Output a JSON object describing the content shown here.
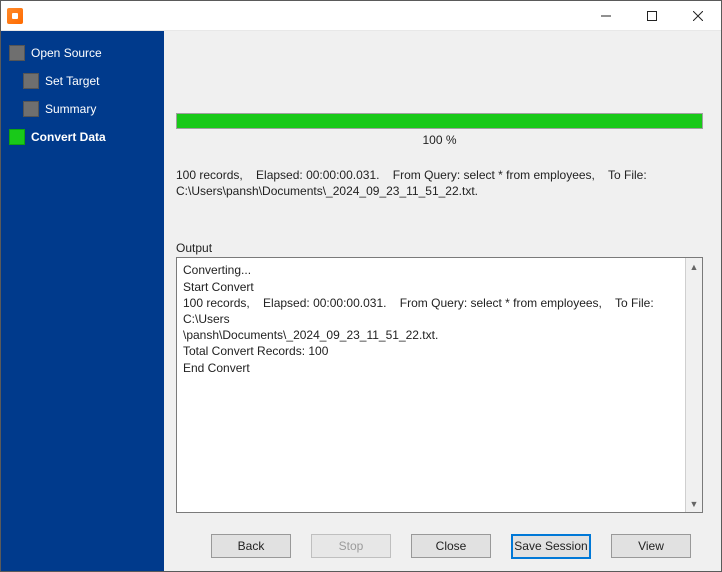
{
  "window": {
    "title": ""
  },
  "sidebar": {
    "items": [
      {
        "label": "Open Source",
        "active": false,
        "child": false
      },
      {
        "label": "Set Target",
        "active": false,
        "child": true
      },
      {
        "label": "Summary",
        "active": false,
        "child": true
      },
      {
        "label": "Convert Data",
        "active": true,
        "child": false
      }
    ]
  },
  "progress": {
    "percent_label": "100 %"
  },
  "summary_line": "100 records,    Elapsed: 00:00:00.031.    From Query: select * from employees,    To File:\nC:\\Users\\pansh\\Documents\\_2024_09_23_11_51_22.txt.",
  "output": {
    "label": "Output",
    "text": "Converting...\nStart Convert\n100 records,    Elapsed: 00:00:00.031.    From Query: select * from employees,    To File: C:\\Users\n\\pansh\\Documents\\_2024_09_23_11_51_22.txt.\nTotal Convert Records: 100\nEnd Convert"
  },
  "buttons": {
    "back": "Back",
    "stop": "Stop",
    "close": "Close",
    "save_session": "Save Session",
    "view": "View"
  }
}
